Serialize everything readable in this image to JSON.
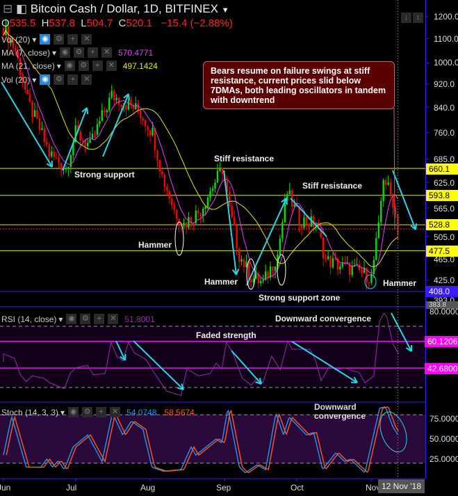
{
  "header": {
    "symbol_title": "Bitcoin Cash / Dollar, 1D, BITFINEX",
    "open_label": "O",
    "open": "535.5",
    "high_label": "H",
    "high": "537.8",
    "low_label": "L",
    "low": "504.7",
    "close_label": "C",
    "close": "520.1",
    "change": "−15.4 (−2.88%)"
  },
  "indicators": {
    "vol_label": "Vol (20)",
    "ma7_label": "MA (7, close)",
    "ma7_value": "570.4771",
    "ma21_label": "MA (21, close)",
    "ma21_value": "497.1424",
    "vol2_label": "Vol (20)",
    "rsi_label": "RSI (14, close)",
    "rsi_value": "51.8001",
    "stoch_label": "Stoch (14, 3, 3)",
    "stoch_k": "54.0748",
    "stoch_d": "58.5674"
  },
  "price_axis": [
    "1200.0",
    "1100.0",
    "1000.0",
    "920.0",
    "840.0",
    "760.0",
    "685.0",
    "625.0",
    "565.0",
    "505.0",
    "465.0",
    "425.0",
    "393.0"
  ],
  "price_tags": {
    "r1": "660.1",
    "r2": "593.8",
    "r3": "528.8",
    "r4": "477.5",
    "support": "408.0",
    "low": "383.8"
  },
  "rsi_axis": {
    "top": "80.0000",
    "upper": "60.1206",
    "lower": "42.6800"
  },
  "stoch_axis": [
    "75.0000",
    "50.0000",
    "25.0000"
  ],
  "months": [
    "Jun",
    "Jul",
    "Aug",
    "Sep",
    "Oct",
    "Nov"
  ],
  "crosshair_date": "12 Nov '18",
  "annotations": {
    "box": "Bears resume on failure swings at stiff resistance, current prices slid below 7DMAs, both leading oscillators in tandem with downtrend",
    "strong_support": "Strong support",
    "stiff_res1": "Stiff resistance",
    "stiff_res2": "Stiff resistance",
    "hammer1": "Hammer",
    "hammer2": "Hammer",
    "hammer3": "Hammer",
    "support_zone": "Strong support zone",
    "rsi_conv": "Downward convergence",
    "faded": "Faded strength",
    "stoch_conv": "Downward convergence"
  },
  "colors": {
    "ma7": "#e040fb",
    "ma21": "#e6e600",
    "rsi": "#9c27b0",
    "stoch_k": "#2196f3",
    "stoch_d": "#ff5722",
    "up": "#00e000",
    "down": "#ff0000",
    "arrow": "#26d7e8"
  },
  "chart_data": {
    "type": "candlestick",
    "x_unit": "days since 1 Jun 2018",
    "price_path": [
      [
        0,
        1150
      ],
      [
        5,
        1050
      ],
      [
        10,
        860
      ],
      [
        19,
        700
      ],
      [
        26,
        660
      ],
      [
        30,
        760
      ],
      [
        36,
        720
      ],
      [
        45,
        880
      ],
      [
        56,
        830
      ],
      [
        62,
        760
      ],
      [
        66,
        640
      ],
      [
        71,
        560
      ],
      [
        75,
        530
      ],
      [
        82,
        560
      ],
      [
        91,
        660
      ],
      [
        94,
        560
      ],
      [
        98,
        470
      ],
      [
        103,
        430
      ],
      [
        108,
        420
      ],
      [
        114,
        470
      ],
      [
        118,
        600
      ],
      [
        123,
        540
      ],
      [
        130,
        530
      ],
      [
        134,
        460
      ],
      [
        140,
        450
      ],
      [
        148,
        440
      ],
      [
        153,
        430
      ],
      [
        156,
        520
      ],
      [
        158,
        640
      ],
      [
        162,
        580
      ],
      [
        164,
        520
      ]
    ],
    "rsi": [
      [
        0,
        46.7
      ],
      [
        0,
        52
      ],
      [
        2.2,
        50.5
      ],
      [
        4.6,
        49
      ],
      [
        7,
        38.3
      ],
      [
        9.5,
        33.8
      ],
      [
        11.9,
        37.6
      ],
      [
        16.8,
        36.1
      ],
      [
        19.2,
        33
      ],
      [
        25.3,
        29.2
      ],
      [
        27.7,
        39.1
      ],
      [
        30.1,
        42.9
      ],
      [
        35,
        44.4
      ],
      [
        37.4,
        38.3
      ],
      [
        42.3,
        39.1
      ],
      [
        44.7,
        59.5
      ],
      [
        47.1,
        50.5
      ],
      [
        49.6,
        47.4
      ],
      [
        52,
        59.5
      ],
      [
        54.4,
        52.7
      ],
      [
        59.3,
        48.2
      ],
      [
        62.9,
        39.1
      ],
      [
        67.8,
        27.7
      ],
      [
        73.8,
        24.7
      ],
      [
        76.3,
        42.1
      ],
      [
        81.1,
        37.6
      ],
      [
        86,
        39.1
      ],
      [
        88.4,
        45.9
      ],
      [
        90.8,
        42.1
      ],
      [
        92.7,
        59.5
      ],
      [
        95.1,
        53.5
      ],
      [
        99.3,
        36.1
      ],
      [
        103,
        31.5
      ],
      [
        105.4,
        36.1
      ],
      [
        107.8,
        33
      ],
      [
        111.5,
        50.5
      ],
      [
        115.1,
        41.4
      ],
      [
        118.2,
        60.3
      ],
      [
        120,
        55
      ],
      [
        127.3,
        55
      ],
      [
        129.7,
        48.2
      ],
      [
        132.1,
        34.5
      ],
      [
        135.8,
        44.4
      ],
      [
        138.2,
        41.4
      ],
      [
        141.8,
        42.9
      ],
      [
        144.3,
        41.4
      ],
      [
        147.9,
        39.8
      ],
      [
        150.3,
        33
      ],
      [
        154,
        37.6
      ],
      [
        156.4,
        73.2
      ],
      [
        158.2,
        78.5
      ],
      [
        159.4,
        76.2
      ],
      [
        161.9,
        58.8
      ],
      [
        164.3,
        52
      ]
    ],
    "rsi_levels": [
      70,
      60.12,
      42.68,
      30
    ],
    "stoch_k": [
      [
        0,
        30
      ],
      [
        3.4,
        78
      ],
      [
        9.5,
        15
      ],
      [
        15.5,
        15
      ],
      [
        18,
        25
      ],
      [
        20.4,
        15
      ],
      [
        22.8,
        23
      ],
      [
        25.3,
        12
      ],
      [
        28.9,
        40
      ],
      [
        35,
        55
      ],
      [
        41,
        22
      ],
      [
        45.3,
        82
      ],
      [
        49.6,
        55
      ],
      [
        53.2,
        72
      ],
      [
        58,
        62
      ],
      [
        61.7,
        15
      ],
      [
        66.6,
        10
      ],
      [
        73.8,
        12
      ],
      [
        78,
        40
      ],
      [
        80,
        30
      ],
      [
        88.4,
        50
      ],
      [
        90.8,
        45
      ],
      [
        93.3,
        88
      ],
      [
        98.1,
        15
      ],
      [
        100.6,
        8
      ],
      [
        105.4,
        18
      ],
      [
        109,
        12
      ],
      [
        113.3,
        82
      ],
      [
        116.4,
        55
      ],
      [
        118.8,
        77
      ],
      [
        126,
        55
      ],
      [
        129,
        58
      ],
      [
        132.7,
        12
      ],
      [
        138.2,
        33
      ],
      [
        141.8,
        22
      ],
      [
        144.3,
        25
      ],
      [
        150.3,
        8
      ],
      [
        156.4,
        88
      ],
      [
        158.8,
        90
      ],
      [
        161.9,
        65
      ],
      [
        164.3,
        54
      ]
    ],
    "stoch_levels": [
      80,
      20
    ],
    "ylim_price": [
      383.8,
      1200
    ]
  }
}
